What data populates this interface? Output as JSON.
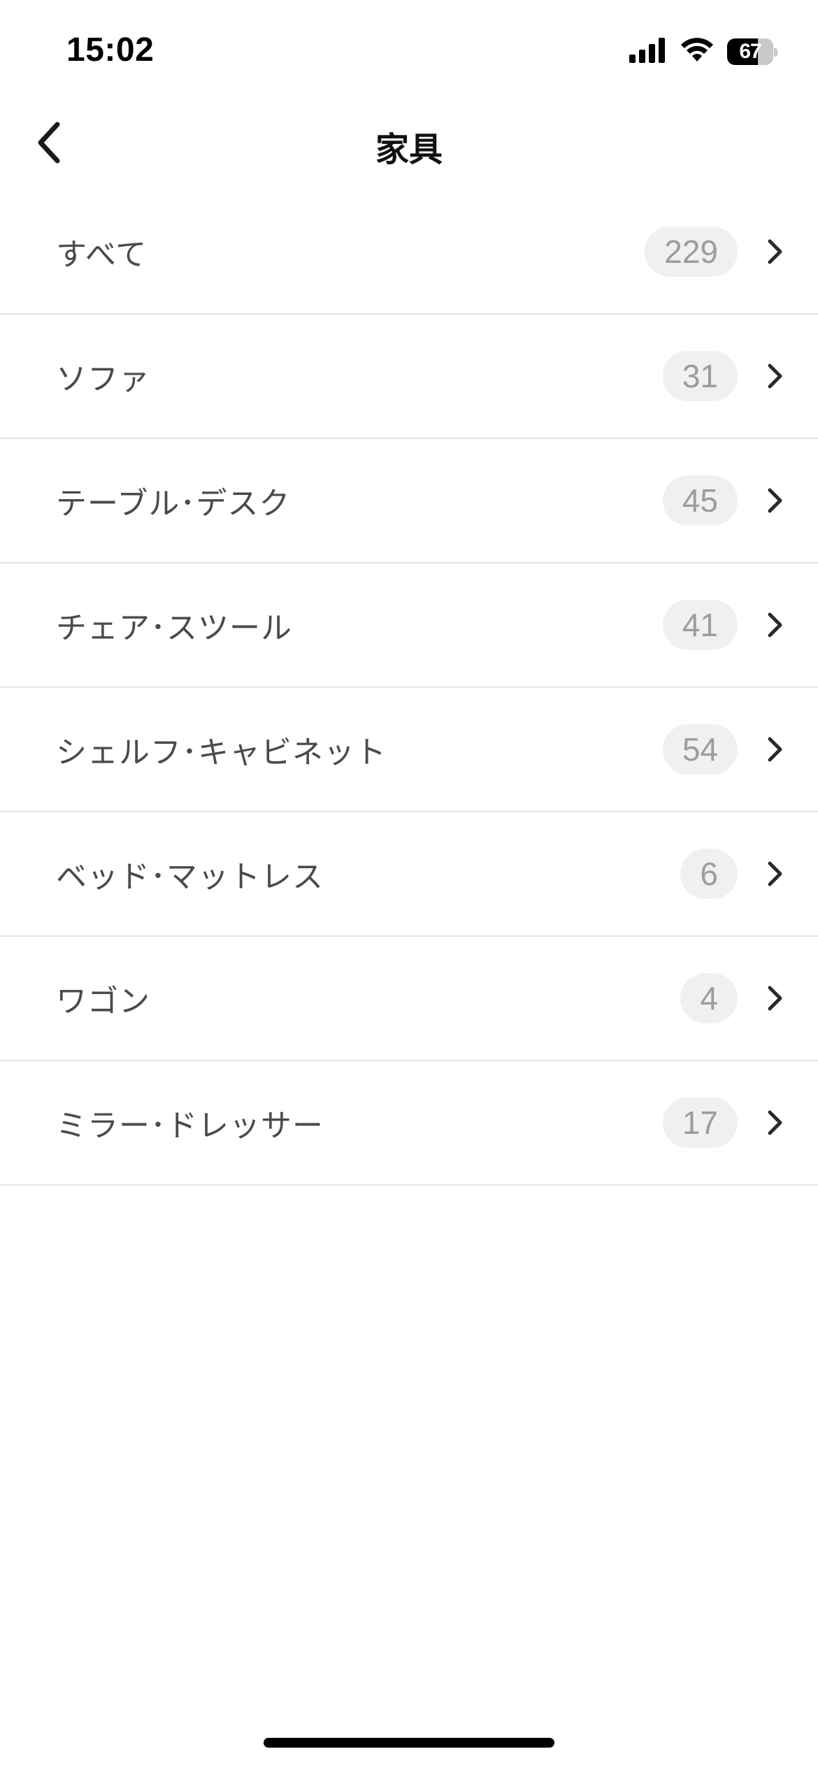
{
  "status_bar": {
    "time": "15:02",
    "battery_level": "67",
    "battery_fraction": 0.67
  },
  "nav": {
    "title": "家具",
    "back_icon": "chevron-left-icon"
  },
  "categories": [
    {
      "label": "すべて",
      "count": "229"
    },
    {
      "label": "ソファ",
      "count": "31"
    },
    {
      "label": "テーブル･デスク",
      "count": "45"
    },
    {
      "label": "チェア･スツール",
      "count": "41"
    },
    {
      "label": "シェルフ･キャビネット",
      "count": "54"
    },
    {
      "label": "ベッド･マットレス",
      "count": "6"
    },
    {
      "label": "ワゴン",
      "count": "4"
    },
    {
      "label": "ミラー･ドレッサー",
      "count": "17"
    }
  ],
  "row_icon": "chevron-right-icon",
  "colors": {
    "label_text": "#4a4a4a",
    "badge_bg": "#f0f0f0",
    "badge_text": "#9c9c9c",
    "divider": "#e4e4e4"
  }
}
